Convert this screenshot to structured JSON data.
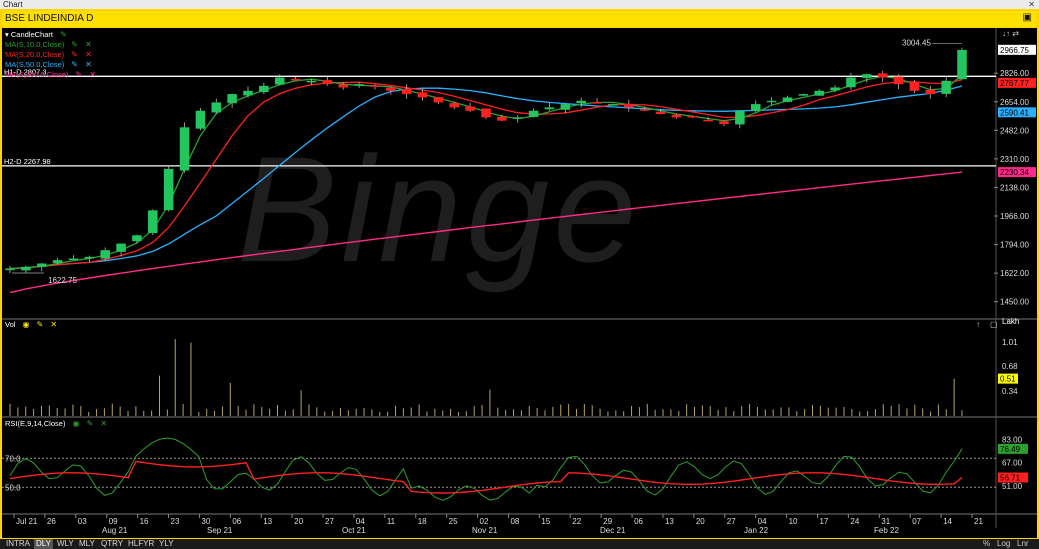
{
  "window": {
    "title": "Chart",
    "close_icon": "close-icon"
  },
  "symbol_bar": {
    "symbol": "BSE LINDEINDIA D",
    "expand_icon": "expand-icon"
  },
  "watermark": "Binge",
  "price_pane": {
    "legend": [
      {
        "label": "CandleChart",
        "color": "#ffffff"
      },
      {
        "label": "MA(S,10.0,Close)",
        "color": "#2ca02c"
      },
      {
        "label": "MA(S,20.0,Close)",
        "color": "#ff2020"
      },
      {
        "label": "MA(S,50.0,Close)",
        "color": "#2ab0ff"
      },
      {
        "label": "MA(S,200.0,Close)",
        "color": "#ff2a8a"
      }
    ],
    "h1": "H1-D 2807.3",
    "h2": "H2-D 2267.98",
    "high_label": "3004.45",
    "low_label": "1622.75",
    "y_ticks": [
      "2826.00",
      "2654.00",
      "2482.00",
      "2310.00",
      "2138.00",
      "1966.00",
      "1794.00",
      "1622.00",
      "1450.00"
    ],
    "tags": [
      {
        "text": "2966.75",
        "bg": "#ffffff",
        "fg": "#000000"
      },
      {
        "text": "2767.77",
        "bg": "#ff2020",
        "fg": "#000000"
      },
      {
        "text": "2590.41",
        "bg": "#2ab0ff",
        "fg": "#000000"
      },
      {
        "text": "2230.34",
        "bg": "#ff2a8a",
        "fg": "#000000"
      }
    ],
    "pin_icons": "↓↑ ⇄"
  },
  "volume_pane": {
    "label": "Vol",
    "unit": "Lakh",
    "y_ticks": [
      "1.01",
      "0.68",
      "0.34"
    ],
    "tag": {
      "text": "0.51",
      "bg": "#ffff00",
      "fg": "#000000"
    }
  },
  "rsi_pane": {
    "label": "RSI(E,9,14,Close)",
    "levels": [
      "70.0",
      "50.0"
    ],
    "y_ticks": [
      "83.00",
      "67.00",
      "51.00"
    ],
    "tags": [
      {
        "text": "76.49",
        "bg": "#2ca02c",
        "fg": "#000000"
      },
      {
        "text": "56.71",
        "bg": "#ff2020",
        "fg": "#000000"
      }
    ]
  },
  "x_axis": {
    "labels": [
      "Jul 21",
      "26",
      "03",
      "09",
      "16",
      "23",
      "30",
      "06",
      "13",
      "20",
      "27",
      "04",
      "11",
      "18",
      "25",
      "02",
      "08",
      "15",
      "22",
      "29",
      "06",
      "13",
      "20",
      "27",
      "04",
      "10",
      "17",
      "24",
      "31",
      "07",
      "14",
      "21"
    ],
    "months": [
      "Aug 21",
      "Sep 21",
      "Oct 21",
      "Nov 21",
      "Dec 21",
      "Jan 22",
      "Feb 22"
    ]
  },
  "timeframes": [
    "INTRA",
    "DLY",
    "WLY",
    "MLY",
    "QTRY",
    "HLFYR",
    "YLY"
  ],
  "active_timeframe": "DLY",
  "bottom_right": [
    "%",
    "Log",
    "Lnr"
  ],
  "chart_data": {
    "type": "candlestick",
    "symbol": "BSE LINDEINDIA D",
    "price_range": [
      1400,
      3050
    ],
    "high": 3004.45,
    "low": 1622.75,
    "last": 2966.75,
    "horizontal_lines": [
      {
        "name": "H1-D",
        "value": 2807.3
      },
      {
        "name": "H2-D",
        "value": 2267.98
      }
    ],
    "series": [
      {
        "name": "MA(S,10.0,Close)",
        "last": 2767.77
      },
      {
        "name": "MA(S,20.0,Close)",
        "last": 2767.77
      },
      {
        "name": "MA(S,50.0,Close)",
        "last": 2590.41
      },
      {
        "name": "MA(S,200.0,Close)",
        "last": 2230.34
      }
    ],
    "close_trend": [
      1650,
      1660,
      1680,
      1700,
      1710,
      1720,
      1760,
      1800,
      1850,
      2000,
      2250,
      2500,
      2600,
      2650,
      2700,
      2720,
      2750,
      2800,
      2790,
      2780,
      2760,
      2740,
      2760,
      2750,
      2720,
      2700,
      2680,
      2650,
      2620,
      2600,
      2560,
      2540,
      2560,
      2600,
      2620,
      2640,
      2660,
      2650,
      2640,
      2620,
      2600,
      2580,
      2560,
      2560,
      2540,
      2520,
      2600,
      2640,
      2660,
      2680,
      2700,
      2720,
      2740,
      2800,
      2820,
      2800,
      2760,
      2720,
      2700,
      2780,
      2966
    ],
    "volume_last": 0.51,
    "rsi_last": [
      76.49,
      56.71
    ]
  }
}
